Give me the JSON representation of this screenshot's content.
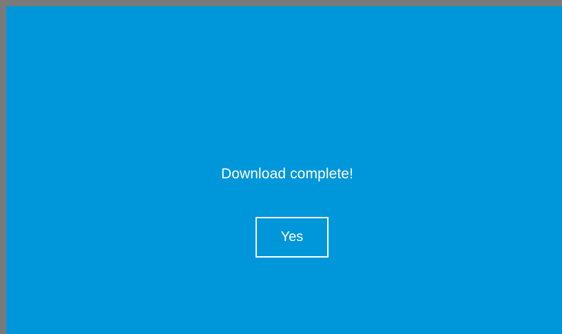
{
  "dialog": {
    "message": "Download complete!",
    "button_label": "Yes"
  },
  "colors": {
    "background": "#0096da",
    "frame": "#7a7a7a",
    "text": "#ffffff"
  }
}
